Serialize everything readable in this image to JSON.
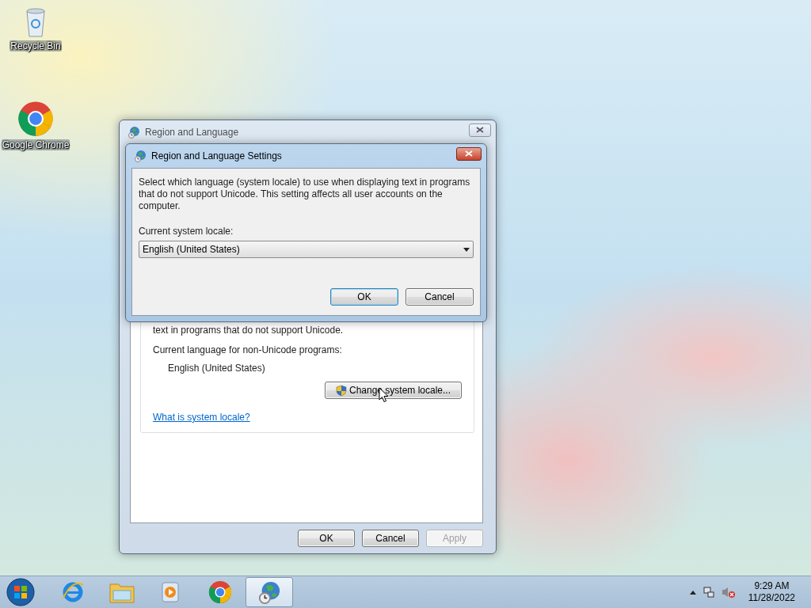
{
  "desktop_icons": [
    {
      "label": "Recycle Bin",
      "kind": "recycle"
    },
    {
      "label": "Google Chrome",
      "kind": "chrome"
    }
  ],
  "main_window": {
    "title": "Region and Language",
    "partial_text": "text in programs that do not support Unicode.",
    "language_label": "Current language for non-Unicode programs:",
    "language_value": "English (United States)",
    "change_button": "Change system locale...",
    "link": "What is system locale?",
    "buttons": [
      {
        "label": "OK",
        "disabled": false
      },
      {
        "label": "Cancel",
        "disabled": false
      },
      {
        "label": "Apply",
        "disabled": true
      }
    ]
  },
  "dialog": {
    "title": "Region and Language Settings",
    "description": "Select which language (system locale) to use when displaying text in programs that do not support Unicode. This setting affects all user accounts on the computer.",
    "locale_label": "Current system locale:",
    "locale_value": "English (United States)",
    "buttons": [
      {
        "label": "OK",
        "default": true
      },
      {
        "label": "Cancel",
        "default": false
      }
    ]
  },
  "taskbar": {
    "items": [
      {
        "kind": "ie",
        "selected": false
      },
      {
        "kind": "explorer",
        "selected": false
      },
      {
        "kind": "media",
        "selected": false
      },
      {
        "kind": "chrome",
        "selected": false
      },
      {
        "kind": "region",
        "selected": true
      }
    ],
    "clock": {
      "time": "9:29 AM",
      "date": "11/28/2022"
    }
  }
}
